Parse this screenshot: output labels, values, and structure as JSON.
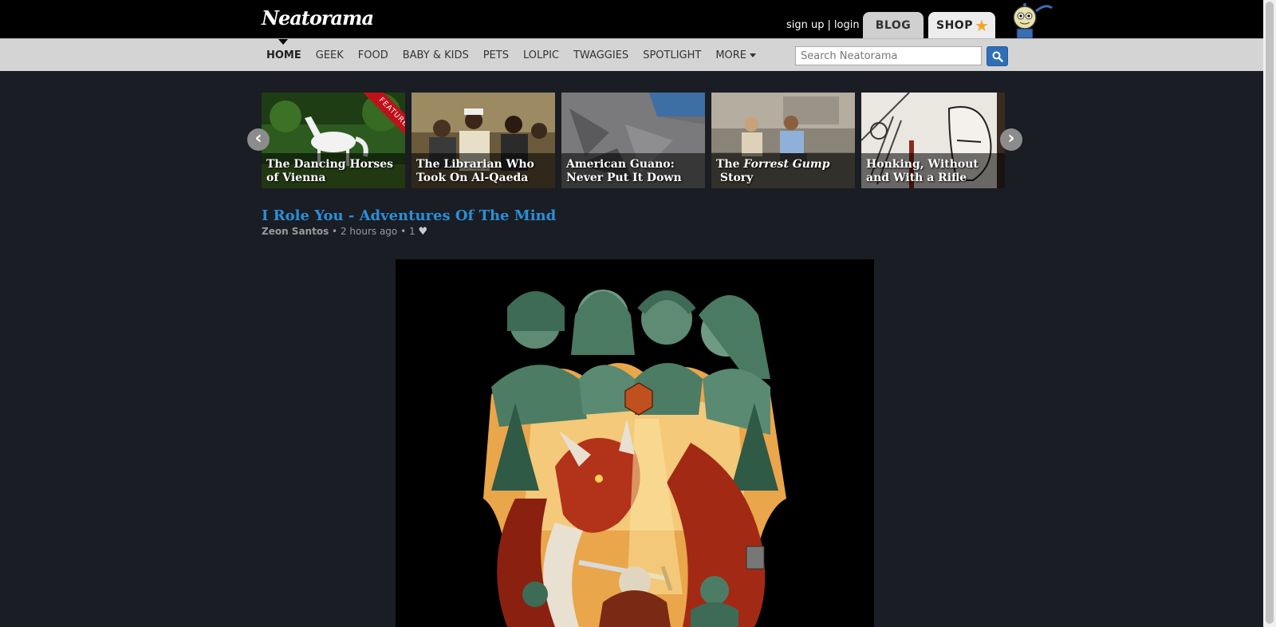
{
  "header": {
    "logo": "Neatorama",
    "sign_up": "sign up",
    "separator": "|",
    "login": "login",
    "tab_blog": "BLOG",
    "tab_shop": "SHOP"
  },
  "nav": {
    "items": [
      "HOME",
      "GEEK",
      "FOOD",
      "BABY & KIDS",
      "PETS",
      "LOLPIC",
      "TWAGGIES",
      "SPOTLIGHT",
      "MORE"
    ],
    "search_placeholder": "Search Neatorama"
  },
  "carousel": {
    "feature_label": "FEATURE",
    "cards": [
      {
        "title": "The Dancing Horses of Vienna"
      },
      {
        "title": "The Librarian Who Took On Al-Qaeda"
      },
      {
        "title": "American Guano: Never Put It Down"
      },
      {
        "title_pre": "The ",
        "title_italic": "Forrest Gump",
        "title_post": " Story"
      },
      {
        "title": "Honking, Without and With a Rifle"
      }
    ]
  },
  "post": {
    "title": "I Role You - Adventures Of The Mind",
    "author": "Zeon Santos",
    "time": "2 hours ago",
    "likes": "1"
  },
  "colors": {
    "page_bg": "#1a1d24",
    "link_blue": "#2a8fd8",
    "search_btn": "#2f6fb7",
    "ribbon_red": "#c0101a"
  }
}
